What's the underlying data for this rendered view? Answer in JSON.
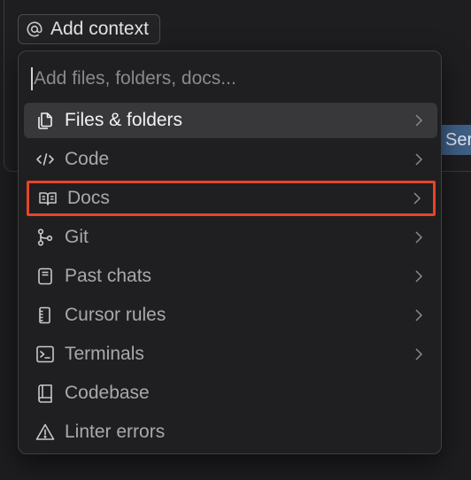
{
  "composer": {
    "context_chip_label": "Add context",
    "send_fragment": "Ser"
  },
  "menu": {
    "search_placeholder": "Add files, folders, docs...",
    "items": [
      {
        "label": "Files & folders",
        "icon": "files-icon",
        "has_submenu": true,
        "state": "hovered"
      },
      {
        "label": "Code",
        "icon": "code-icon",
        "has_submenu": true
      },
      {
        "label": "Docs",
        "icon": "book-icon",
        "has_submenu": true,
        "state": "annotated"
      },
      {
        "label": "Git",
        "icon": "git-branch-icon",
        "has_submenu": true
      },
      {
        "label": "Past chats",
        "icon": "chat-history-icon",
        "has_submenu": true
      },
      {
        "label": "Cursor rules",
        "icon": "rules-icon",
        "has_submenu": true
      },
      {
        "label": "Terminals",
        "icon": "terminal-icon",
        "has_submenu": true
      },
      {
        "label": "Codebase",
        "icon": "codebase-icon",
        "has_submenu": false
      },
      {
        "label": "Linter errors",
        "icon": "warning-icon",
        "has_submenu": false
      }
    ]
  },
  "colors": {
    "background": "#1d1d1f",
    "menu_bg": "#1f1f21",
    "hover_bg": "#38383b",
    "annotation": "#e8432a",
    "send_button": "#3f5f86"
  }
}
